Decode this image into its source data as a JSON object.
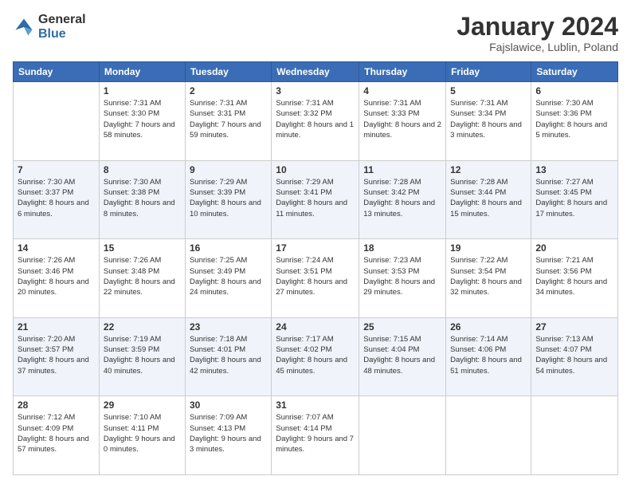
{
  "logo": {
    "general": "General",
    "blue": "Blue"
  },
  "title": "January 2024",
  "subtitle": "Fajslawice, Lublin, Poland",
  "headers": [
    "Sunday",
    "Monday",
    "Tuesday",
    "Wednesday",
    "Thursday",
    "Friday",
    "Saturday"
  ],
  "weeks": [
    [
      {
        "day": "",
        "sunrise": "",
        "sunset": "",
        "daylight": ""
      },
      {
        "day": "1",
        "sunrise": "Sunrise: 7:31 AM",
        "sunset": "Sunset: 3:30 PM",
        "daylight": "Daylight: 7 hours and 58 minutes."
      },
      {
        "day": "2",
        "sunrise": "Sunrise: 7:31 AM",
        "sunset": "Sunset: 3:31 PM",
        "daylight": "Daylight: 7 hours and 59 minutes."
      },
      {
        "day": "3",
        "sunrise": "Sunrise: 7:31 AM",
        "sunset": "Sunset: 3:32 PM",
        "daylight": "Daylight: 8 hours and 1 minute."
      },
      {
        "day": "4",
        "sunrise": "Sunrise: 7:31 AM",
        "sunset": "Sunset: 3:33 PM",
        "daylight": "Daylight: 8 hours and 2 minutes."
      },
      {
        "day": "5",
        "sunrise": "Sunrise: 7:31 AM",
        "sunset": "Sunset: 3:34 PM",
        "daylight": "Daylight: 8 hours and 3 minutes."
      },
      {
        "day": "6",
        "sunrise": "Sunrise: 7:30 AM",
        "sunset": "Sunset: 3:36 PM",
        "daylight": "Daylight: 8 hours and 5 minutes."
      }
    ],
    [
      {
        "day": "7",
        "sunrise": "Sunrise: 7:30 AM",
        "sunset": "Sunset: 3:37 PM",
        "daylight": "Daylight: 8 hours and 6 minutes."
      },
      {
        "day": "8",
        "sunrise": "Sunrise: 7:30 AM",
        "sunset": "Sunset: 3:38 PM",
        "daylight": "Daylight: 8 hours and 8 minutes."
      },
      {
        "day": "9",
        "sunrise": "Sunrise: 7:29 AM",
        "sunset": "Sunset: 3:39 PM",
        "daylight": "Daylight: 8 hours and 10 minutes."
      },
      {
        "day": "10",
        "sunrise": "Sunrise: 7:29 AM",
        "sunset": "Sunset: 3:41 PM",
        "daylight": "Daylight: 8 hours and 11 minutes."
      },
      {
        "day": "11",
        "sunrise": "Sunrise: 7:28 AM",
        "sunset": "Sunset: 3:42 PM",
        "daylight": "Daylight: 8 hours and 13 minutes."
      },
      {
        "day": "12",
        "sunrise": "Sunrise: 7:28 AM",
        "sunset": "Sunset: 3:44 PM",
        "daylight": "Daylight: 8 hours and 15 minutes."
      },
      {
        "day": "13",
        "sunrise": "Sunrise: 7:27 AM",
        "sunset": "Sunset: 3:45 PM",
        "daylight": "Daylight: 8 hours and 17 minutes."
      }
    ],
    [
      {
        "day": "14",
        "sunrise": "Sunrise: 7:26 AM",
        "sunset": "Sunset: 3:46 PM",
        "daylight": "Daylight: 8 hours and 20 minutes."
      },
      {
        "day": "15",
        "sunrise": "Sunrise: 7:26 AM",
        "sunset": "Sunset: 3:48 PM",
        "daylight": "Daylight: 8 hours and 22 minutes."
      },
      {
        "day": "16",
        "sunrise": "Sunrise: 7:25 AM",
        "sunset": "Sunset: 3:49 PM",
        "daylight": "Daylight: 8 hours and 24 minutes."
      },
      {
        "day": "17",
        "sunrise": "Sunrise: 7:24 AM",
        "sunset": "Sunset: 3:51 PM",
        "daylight": "Daylight: 8 hours and 27 minutes."
      },
      {
        "day": "18",
        "sunrise": "Sunrise: 7:23 AM",
        "sunset": "Sunset: 3:53 PM",
        "daylight": "Daylight: 8 hours and 29 minutes."
      },
      {
        "day": "19",
        "sunrise": "Sunrise: 7:22 AM",
        "sunset": "Sunset: 3:54 PM",
        "daylight": "Daylight: 8 hours and 32 minutes."
      },
      {
        "day": "20",
        "sunrise": "Sunrise: 7:21 AM",
        "sunset": "Sunset: 3:56 PM",
        "daylight": "Daylight: 8 hours and 34 minutes."
      }
    ],
    [
      {
        "day": "21",
        "sunrise": "Sunrise: 7:20 AM",
        "sunset": "Sunset: 3:57 PM",
        "daylight": "Daylight: 8 hours and 37 minutes."
      },
      {
        "day": "22",
        "sunrise": "Sunrise: 7:19 AM",
        "sunset": "Sunset: 3:59 PM",
        "daylight": "Daylight: 8 hours and 40 minutes."
      },
      {
        "day": "23",
        "sunrise": "Sunrise: 7:18 AM",
        "sunset": "Sunset: 4:01 PM",
        "daylight": "Daylight: 8 hours and 42 minutes."
      },
      {
        "day": "24",
        "sunrise": "Sunrise: 7:17 AM",
        "sunset": "Sunset: 4:02 PM",
        "daylight": "Daylight: 8 hours and 45 minutes."
      },
      {
        "day": "25",
        "sunrise": "Sunrise: 7:15 AM",
        "sunset": "Sunset: 4:04 PM",
        "daylight": "Daylight: 8 hours and 48 minutes."
      },
      {
        "day": "26",
        "sunrise": "Sunrise: 7:14 AM",
        "sunset": "Sunset: 4:06 PM",
        "daylight": "Daylight: 8 hours and 51 minutes."
      },
      {
        "day": "27",
        "sunrise": "Sunrise: 7:13 AM",
        "sunset": "Sunset: 4:07 PM",
        "daylight": "Daylight: 8 hours and 54 minutes."
      }
    ],
    [
      {
        "day": "28",
        "sunrise": "Sunrise: 7:12 AM",
        "sunset": "Sunset: 4:09 PM",
        "daylight": "Daylight: 8 hours and 57 minutes."
      },
      {
        "day": "29",
        "sunrise": "Sunrise: 7:10 AM",
        "sunset": "Sunset: 4:11 PM",
        "daylight": "Daylight: 9 hours and 0 minutes."
      },
      {
        "day": "30",
        "sunrise": "Sunrise: 7:09 AM",
        "sunset": "Sunset: 4:13 PM",
        "daylight": "Daylight: 9 hours and 3 minutes."
      },
      {
        "day": "31",
        "sunrise": "Sunrise: 7:07 AM",
        "sunset": "Sunset: 4:14 PM",
        "daylight": "Daylight: 9 hours and 7 minutes."
      },
      {
        "day": "",
        "sunrise": "",
        "sunset": "",
        "daylight": ""
      },
      {
        "day": "",
        "sunrise": "",
        "sunset": "",
        "daylight": ""
      },
      {
        "day": "",
        "sunrise": "",
        "sunset": "",
        "daylight": ""
      }
    ]
  ]
}
